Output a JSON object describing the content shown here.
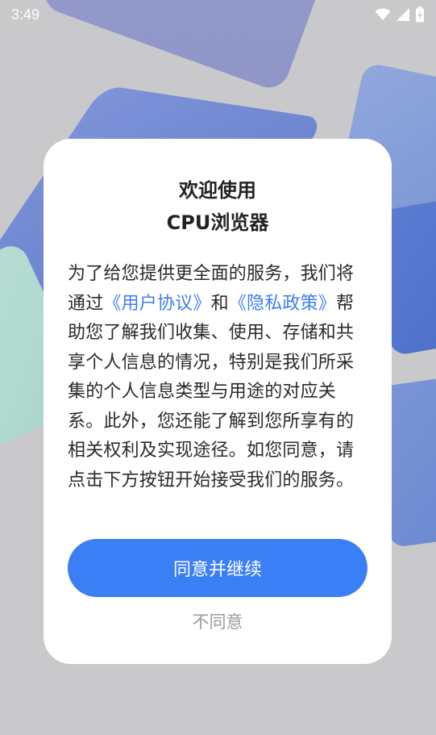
{
  "status_bar": {
    "time": "3:49",
    "icons": [
      "wifi-icon",
      "cellular-signal-icon",
      "battery-charging-icon"
    ]
  },
  "dialog": {
    "title_line1": "欢迎使用",
    "title_line2": "CPU浏览器",
    "body": {
      "text1": "为了给您提供更全面的服务，我们将通过",
      "link_user_agreement": "《用户协议》",
      "text2": "和",
      "link_privacy_policy": "《隐私政策》",
      "text3": "帮助您了解我们收集、使用、存储和共享个人信息的情况，特别是我们所采集的个人信息类型与用途的对应关系。此外，您还能了解到您所享有的相关权利及实现途径。如您同意，请点击下方按钮开始接受我们的服务。"
    },
    "agree_button": "同意并继续",
    "disagree_button": "不同意"
  },
  "colors": {
    "accent": "#3a7ff6",
    "link": "#3d7ef0",
    "background": "#c9c9cb"
  }
}
